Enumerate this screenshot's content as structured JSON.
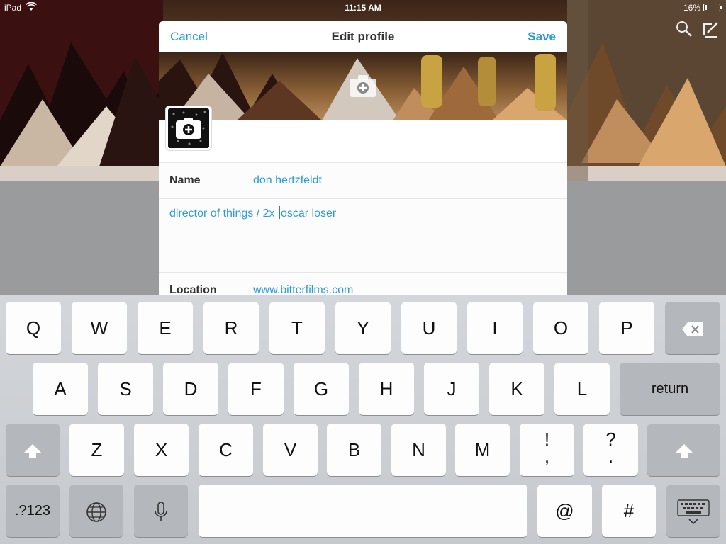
{
  "status": {
    "device": "iPad",
    "time": "11:15 AM",
    "battery": "16%",
    "battery_level": 0.16
  },
  "modal": {
    "cancel_label": "Cancel",
    "title": "Edit profile",
    "save_label": "Save"
  },
  "fields": {
    "name_label": "Name",
    "name_value": "don hertzfeldt",
    "bio_before_cursor": "director of things / 2x ",
    "bio_after_cursor": "oscar loser",
    "location_label": "Location",
    "location_value": "www.bitterfilms.com"
  },
  "keyboard": {
    "row1": [
      "Q",
      "W",
      "E",
      "R",
      "T",
      "Y",
      "U",
      "I",
      "O",
      "P"
    ],
    "row2": [
      "A",
      "S",
      "D",
      "F",
      "G",
      "H",
      "J",
      "K",
      "L"
    ],
    "return_label": "return",
    "row3": [
      "Z",
      "X",
      "C",
      "V",
      "B",
      "N",
      "M"
    ],
    "punct1": [
      "!",
      ","
    ],
    "punct2": [
      "?",
      "."
    ],
    "numbers_label": ".?123",
    "at_label": "@",
    "hash_label": "#"
  },
  "icons": {
    "header_top_right": [
      "search-icon",
      "compose-icon"
    ],
    "header_photo": "add-photo-icon",
    "avatar": "add-photo-icon",
    "keyboard": [
      "delete-icon",
      "shift-icon",
      "globe-icon",
      "microphone-icon",
      "hide-keyboard-icon"
    ]
  },
  "colors": {
    "accent": "#2a9bd8",
    "keyboard_bg": "#d3d6da",
    "key_bg": "#fdfdfd",
    "key_dark_bg": "#b4b8bd"
  }
}
